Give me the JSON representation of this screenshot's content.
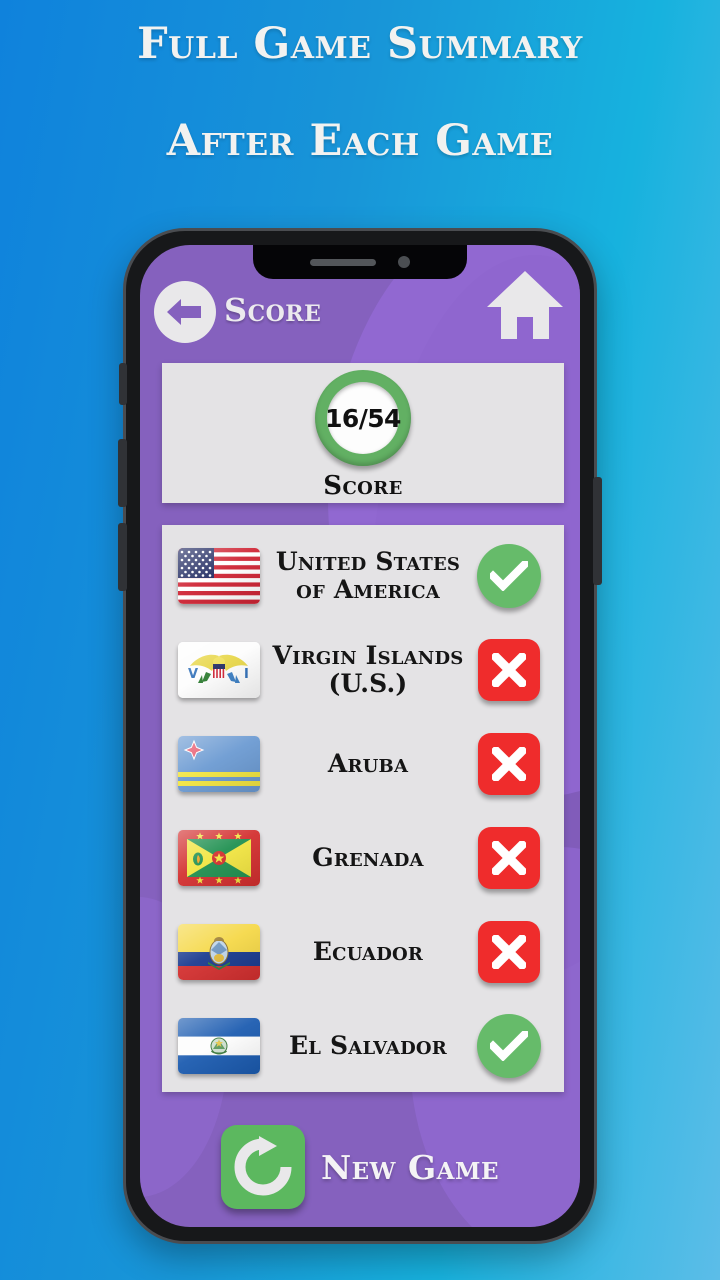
{
  "headline": {
    "line1": "Full Game Summary",
    "line2": "After Each Game"
  },
  "colors": {
    "background_start": "#0f82dc",
    "background_end": "#5cbde8",
    "app_purple": "#8561be",
    "panel_gray": "#e4e3e5",
    "correct_green": "#66bb6a",
    "wrong_red": "#ef2c2c",
    "ring_green": "#62b063",
    "newgame_green": "#5cb85f"
  },
  "app": {
    "header": {
      "back_icon": "back-arrow-icon",
      "title": "Score",
      "home_icon": "home-icon"
    },
    "score_panel": {
      "value": "16/54",
      "correct": 16,
      "total": 54,
      "caption": "Score"
    },
    "results": [
      {
        "country": "United States of America",
        "flag": "us",
        "status": "correct",
        "status_icon": "check-icon"
      },
      {
        "country": "Virgin Islands (U.S.)",
        "flag": "vi",
        "status": "wrong",
        "status_icon": "cross-icon"
      },
      {
        "country": "Aruba",
        "flag": "aw",
        "status": "wrong",
        "status_icon": "cross-icon"
      },
      {
        "country": "Grenada",
        "flag": "gd",
        "status": "wrong",
        "status_icon": "cross-icon"
      },
      {
        "country": "Ecuador",
        "flag": "ec",
        "status": "wrong",
        "status_icon": "cross-icon"
      },
      {
        "country": "El Salvador",
        "flag": "sv",
        "status": "correct",
        "status_icon": "check-icon"
      }
    ],
    "new_game": {
      "label": "New Game",
      "icon": "refresh-icon"
    }
  }
}
